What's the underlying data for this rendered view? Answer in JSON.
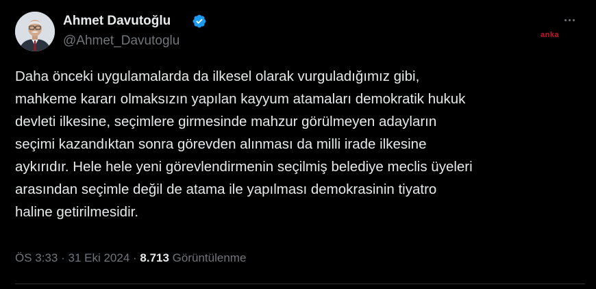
{
  "author": {
    "display_name": "Ahmet Davutoğlu",
    "handle": "@Ahmet_Davutoglu",
    "verified_icon": "verified-badge-icon",
    "avatar_icon": "profile-photo"
  },
  "watermark": "anka",
  "more_icon": "more-dots-icon",
  "tweet": {
    "lines": [
      "Daha önceki uygulamalarda da ilkesel olarak vurguladığımız gibi,",
      "mahkeme kararı olmaksızın yapılan kayyum atamaları demokratik hukuk",
      "devleti ilkesine, seçimlere girmesinde mahzur görülmeyen adayların",
      "seçimi kazandıktan sonra görevden alınması da milli irade ilkesine",
      "aykırıdır. Hele hele yeni görevlendirmenin seçilmiş belediye meclis üyeleri",
      "arasından seçimle değil de atama ile yapılması demokrasinin tiyatro",
      "haline getirilmesidir."
    ]
  },
  "meta": {
    "time": "ÖS 3:33",
    "separator": " · ",
    "date": "31 Eki 2024",
    "views_count": "8.713",
    "views_label": "Görüntülenme"
  },
  "colors": {
    "background": "#000000",
    "text": "#e7e9ea",
    "secondary": "#71767b",
    "verified": "#1d9bf0",
    "watermark": "#c8102e"
  }
}
